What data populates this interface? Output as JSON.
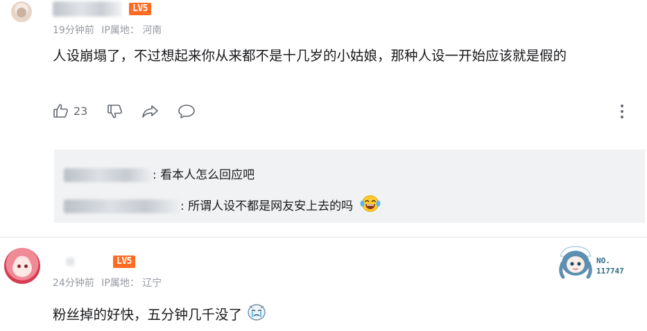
{
  "comment1": {
    "level": "LV5",
    "time": "19分钟前",
    "ip_label": "IP属地：",
    "ip_location": "河南",
    "content": "人设崩塌了，不过想起来你从来都不是十几岁的小姑娘，那种人设一开始应该就是假的",
    "like_count": "23"
  },
  "replies": [
    {
      "text": ": 看本人怎么回应吧"
    },
    {
      "text": ": 所谓人设不都是网友安上去的吗"
    }
  ],
  "comment2": {
    "level": "LV5",
    "time": "24分钟前",
    "ip_label": "IP属地：",
    "ip_location": "辽宁",
    "content": "粉丝掉的好快，五分钟几千没了",
    "badge_no_label": "NO.",
    "badge_number": "117747"
  },
  "colors": {
    "level_badge": "#ff6b23",
    "meta_text": "#9499a0",
    "reply_bg": "#f1f2f3",
    "icon": "#61666d"
  },
  "icons": [
    "like-icon",
    "dislike-icon",
    "share-icon",
    "reply-icon",
    "more-icon",
    "laugh-cry-emoji",
    "crying-emoji"
  ]
}
